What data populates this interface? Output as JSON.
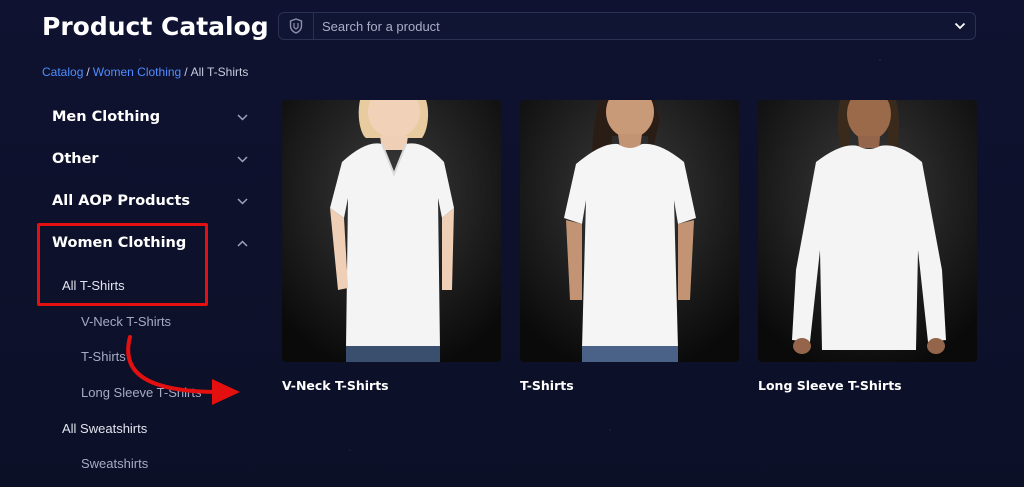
{
  "header": {
    "title": "Product Catalog",
    "search_placeholder": "Search for a product"
  },
  "breadcrumb": {
    "items": [
      "Catalog",
      "Women Clothing"
    ],
    "current": "All T-Shirts",
    "separator": "/"
  },
  "sidebar": {
    "categories": [
      {
        "label": "Men Clothing",
        "expanded": false
      },
      {
        "label": "Other",
        "expanded": false
      },
      {
        "label": "All AOP Products",
        "expanded": false
      },
      {
        "label": "Women Clothing",
        "expanded": true
      }
    ],
    "subcategories": [
      {
        "label": "All T-Shirts"
      },
      {
        "label": "V-Neck T-Shirts"
      },
      {
        "label": "T-Shirts"
      },
      {
        "label": "Long Sleeve T-Shirts"
      },
      {
        "label": "All Sweatshirts"
      },
      {
        "label": "Sweatshirts"
      }
    ]
  },
  "products": [
    {
      "title": "V-Neck T-Shirts",
      "image": "woman-v-neck-tshirt"
    },
    {
      "title": "T-Shirts",
      "image": "woman-crew-tshirt"
    },
    {
      "title": "Long Sleeve T-Shirts",
      "image": "woman-long-sleeve-tshirt"
    }
  ],
  "colors": {
    "background": "#0e1129",
    "link": "#4f8dff",
    "annotation": "#e41010"
  }
}
